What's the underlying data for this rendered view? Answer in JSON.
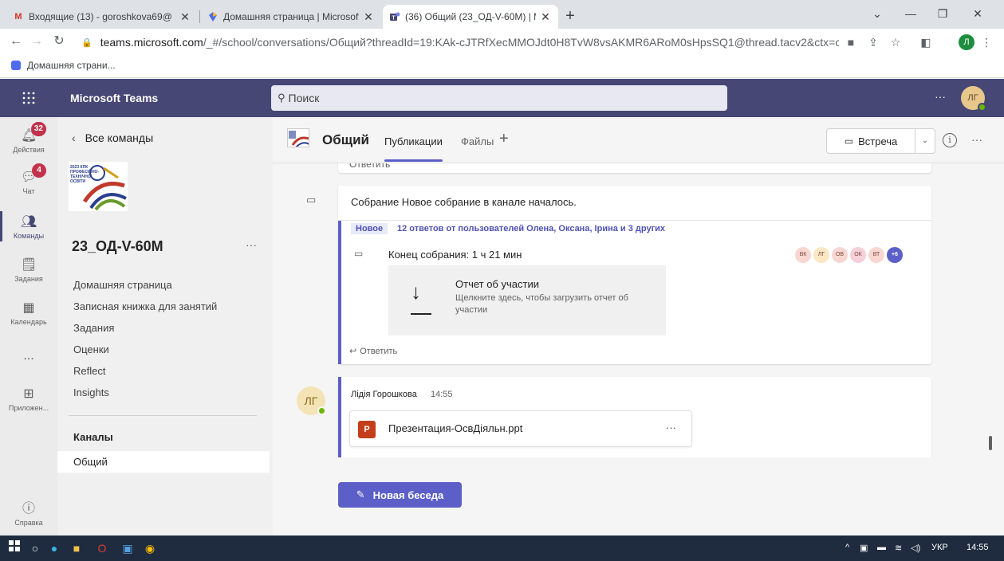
{
  "browser": {
    "tabs": [
      {
        "title": "Входящие (13) - goroshkova69@",
        "favicon": "gmail-icon"
      },
      {
        "title": "Домашняя страница | Microsoft",
        "favicon": "teams-home-icon"
      },
      {
        "title": "(36) Общий (23_ОД-V-60М) | Mi",
        "favicon": "teams-icon"
      }
    ],
    "url_host": "teams.microsoft.com",
    "url_path": "/_#/school/conversations/Общий?threadId=19:KAk-cJTRfXecMMOJdt0H8TvW8vsAKMR6ARoM0sHpsSQ1@thread.tacv2&ctx=c...",
    "bookmark": "Домашняя страни...",
    "profile_initial": "Л"
  },
  "teams": {
    "app_name": "Microsoft Teams",
    "search_placeholder": "Поиск",
    "user_initials": "ЛГ"
  },
  "rail": {
    "activity": {
      "label": "Действия",
      "badge": "32"
    },
    "chat": {
      "label": "Чат",
      "badge": "4"
    },
    "teams": {
      "label": "Команды"
    },
    "assignments": {
      "label": "Задания"
    },
    "calendar": {
      "label": "Календарь"
    },
    "more": {
      "label": "..."
    },
    "apps": {
      "label": "Приложен..."
    },
    "help": {
      "label": "Справка"
    }
  },
  "team_panel": {
    "back_label": "Все команды",
    "team_name": "23_ОД-V-60М",
    "logo_text": "2023 КПК ПРОФЕСІЙНО-ТЕХНІЧНОЇ ОСВІТИ",
    "links": [
      "Домашняя страница",
      "Записная книжка для занятий",
      "Задания",
      "Оценки",
      "Reflect",
      "Insights"
    ],
    "channels_heading": "Каналы",
    "channel": "Общий"
  },
  "channel": {
    "title": "Общий",
    "tabs": [
      "Публикации",
      "Файлы"
    ],
    "meet_label": "Встреча"
  },
  "feed": {
    "prev_reply": "Ответить",
    "meeting": {
      "title": "Собрание Новое собрание в канале началось.",
      "new_badge": "Новое",
      "replies": "12 ответов от пользователей Олена, Оксана, Ірина и 3 других",
      "ended": "Конец собрания: 1 ч 21 мин",
      "participants": [
        {
          "initials": "ВК",
          "color": "#f8d7d3"
        },
        {
          "initials": "ЛГ",
          "color": "#fbe7c4"
        },
        {
          "initials": "ОВ",
          "color": "#f8d7d3"
        },
        {
          "initials": "ОК",
          "color": "#f6d0d9"
        },
        {
          "initials": "ВТ",
          "color": "#f8d7d3"
        }
      ],
      "participants_more": "+6",
      "report_title": "Отчет об участии",
      "report_desc": "Щелкните здесь, чтобы загрузить отчет об участии",
      "reply": "Ответить"
    },
    "post": {
      "author": "Лідія Горошкова",
      "time": "14:55",
      "avatar": "ЛГ",
      "file_name": "Презентация-ОсвДіяльн.ppt",
      "file_badge": "P"
    }
  },
  "new_conversation": "Новая беседа",
  "taskbar": {
    "lang": "УКР",
    "time": "14:55"
  }
}
